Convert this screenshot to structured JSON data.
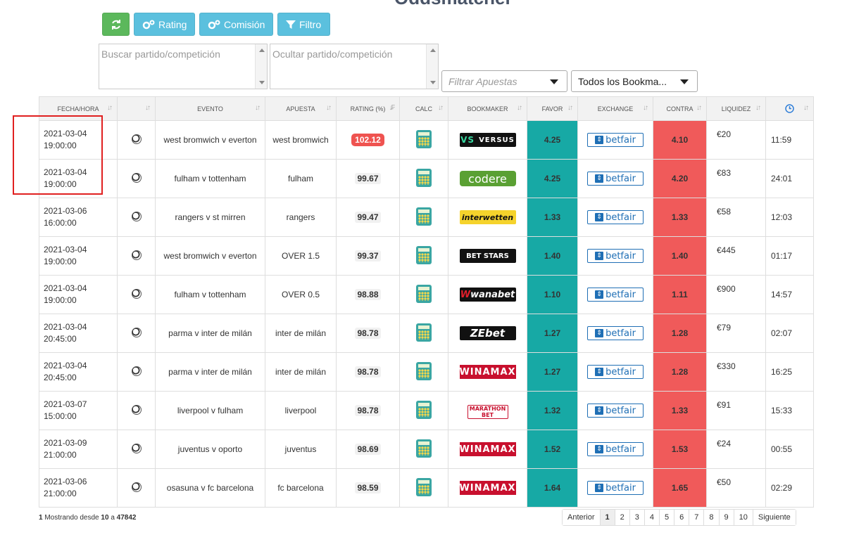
{
  "toolbar": {
    "refresh_icon": "refresh-icon",
    "rating_label": "Rating",
    "comision_label": "Comisión",
    "filtro_label": "Filtro"
  },
  "filters": {
    "search_placeholder": "Buscar partido/competición",
    "hide_placeholder": "Ocultar partido/competición",
    "apuestas_placeholder": "Filtrar Apuestas",
    "bookmakers_value": "Todos los Bookma..."
  },
  "columns": {
    "fecha": "FECHA/HORA",
    "evento": "EVENTO",
    "apuesta": "APUESTA",
    "rating": "RATING (%)",
    "calc": "CALC",
    "bookmaker": "BOOKMAKER",
    "favor": "FAVOR",
    "exchange": "EXCHANGE",
    "contra": "CONTRA",
    "liquidez": "LIQUIDEZ"
  },
  "rows": [
    {
      "date": "2021-03-04",
      "time": "19:00:00",
      "event": "west bromwich v everton",
      "bet": "west bromwich",
      "rating": "102.12",
      "hot": true,
      "bk": "versus",
      "bk_label": "VERSUS",
      "favor": "4.25",
      "exchange": "betfair",
      "contra": "4.10",
      "liq": "€20",
      "clock": "11:59"
    },
    {
      "date": "2021-03-04",
      "time": "19:00:00",
      "event": "fulham v tottenham",
      "bet": "fulham",
      "rating": "99.67",
      "hot": false,
      "bk": "codere",
      "bk_label": "codere",
      "favor": "4.25",
      "exchange": "betfair",
      "contra": "4.20",
      "liq": "€83",
      "clock": "24:01"
    },
    {
      "date": "2021-03-06",
      "time": "16:00:00",
      "event": "rangers v st mirren",
      "bet": "rangers",
      "rating": "99.47",
      "hot": false,
      "bk": "interwetten",
      "bk_label": "interwetten",
      "favor": "1.33",
      "exchange": "betfair",
      "contra": "1.33",
      "liq": "€58",
      "clock": "12:03"
    },
    {
      "date": "2021-03-04",
      "time": "19:00:00",
      "event": "west bromwich v everton",
      "bet": "OVER 1.5",
      "rating": "99.37",
      "hot": false,
      "bk": "pokerstars",
      "bk_label": "BET STARS",
      "favor": "1.40",
      "exchange": "betfair",
      "contra": "1.40",
      "liq": "€445",
      "clock": "01:17"
    },
    {
      "date": "2021-03-04",
      "time": "19:00:00",
      "event": "fulham v tottenham",
      "bet": "OVER 0.5",
      "rating": "98.88",
      "hot": false,
      "bk": "wanabet",
      "bk_label": "wanabet",
      "favor": "1.10",
      "exchange": "betfair",
      "contra": "1.11",
      "liq": "€900",
      "clock": "14:57"
    },
    {
      "date": "2021-03-04",
      "time": "20:45:00",
      "event": "parma v inter de milán",
      "bet": "inter de milán",
      "rating": "98.78",
      "hot": false,
      "bk": "zebet",
      "bk_label": "ZEbet",
      "favor": "1.27",
      "exchange": "betfair",
      "contra": "1.28",
      "liq": "€79",
      "clock": "02:07"
    },
    {
      "date": "2021-03-04",
      "time": "20:45:00",
      "event": "parma v inter de milán",
      "bet": "inter de milán",
      "rating": "98.78",
      "hot": false,
      "bk": "winamax",
      "bk_label": "WINAMAX",
      "favor": "1.27",
      "exchange": "betfair",
      "contra": "1.28",
      "liq": "€330",
      "clock": "16:25"
    },
    {
      "date": "2021-03-07",
      "time": "15:00:00",
      "event": "liverpool v fulham",
      "bet": "liverpool",
      "rating": "98.78",
      "hot": false,
      "bk": "marathon",
      "bk_label": "MARATHON BET",
      "favor": "1.32",
      "exchange": "betfair",
      "contra": "1.33",
      "liq": "€91",
      "clock": "15:33"
    },
    {
      "date": "2021-03-09",
      "time": "21:00:00",
      "event": "juventus v oporto",
      "bet": "juventus",
      "rating": "98.69",
      "hot": false,
      "bk": "winamax",
      "bk_label": "WINAMAX",
      "favor": "1.52",
      "exchange": "betfair",
      "contra": "1.53",
      "liq": "€24",
      "clock": "00:55"
    },
    {
      "date": "2021-03-06",
      "time": "21:00:00",
      "event": "osasuna v fc barcelona",
      "bet": "fc barcelona",
      "rating": "98.59",
      "hot": false,
      "bk": "winamax",
      "bk_label": "WINAMAX",
      "favor": "1.64",
      "exchange": "betfair",
      "contra": "1.65",
      "liq": "€50",
      "clock": "02:29"
    }
  ],
  "footer": {
    "page": "1",
    "text_a": "Mostrando desde",
    "from": "10",
    "text_b": "a",
    "total": "47842"
  },
  "pagination": {
    "prev": "Anterior",
    "pages": [
      "1",
      "2",
      "3",
      "4",
      "5",
      "6",
      "7",
      "8",
      "9",
      "10"
    ],
    "next": "Siguiente",
    "active": "1"
  },
  "colors": {
    "favor": "#17a9a5",
    "contra": "#f05a5a",
    "btn_green": "#5cb85c",
    "btn_blue": "#5bc0de"
  }
}
